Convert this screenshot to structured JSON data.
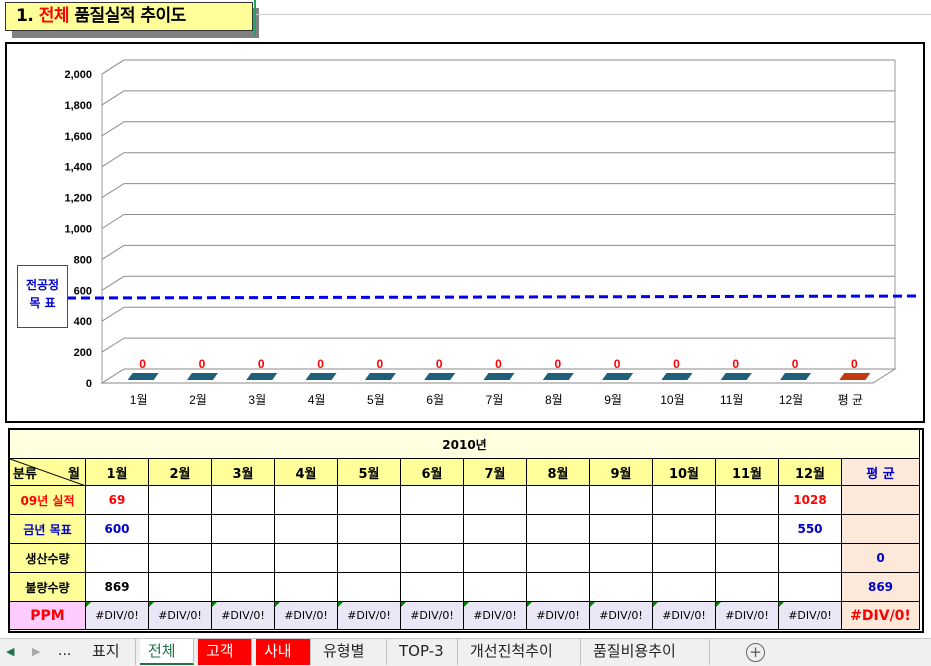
{
  "title": {
    "num": "1.",
    "highlight": "전체",
    "rest": "품질실적 추이도"
  },
  "target_label": {
    "line1": "전공정",
    "line2": "목 표"
  },
  "chart_data": {
    "type": "bar",
    "title": "",
    "categories": [
      "1월",
      "2월",
      "3월",
      "4월",
      "5월",
      "6월",
      "7월",
      "8월",
      "9월",
      "10월",
      "11월",
      "12월",
      "평 균"
    ],
    "series": [
      {
        "values": [
          0,
          0,
          0,
          0,
          0,
          0,
          0,
          0,
          0,
          0,
          0,
          0,
          0
        ]
      }
    ],
    "data_labels": [
      "0",
      "0",
      "0",
      "0",
      "0",
      "0",
      "0",
      "0",
      "0",
      "0",
      "0",
      "0",
      "0"
    ],
    "yticks": [
      "0",
      "200",
      "400",
      "600",
      "800",
      "1,000",
      "1,200",
      "1,400",
      "1,600",
      "1,800",
      "2,000"
    ],
    "ylim": [
      0,
      2000
    ],
    "target_line_value": 550,
    "colors": {
      "bar": "#1f5f7a",
      "avg_bar": "#c0390f",
      "target_line": "#0000ee",
      "labels": "#ff0000"
    }
  },
  "table": {
    "year_label": "2010년",
    "corner_left": "분류",
    "corner_right": "월",
    "months": [
      "1월",
      "2월",
      "3월",
      "4월",
      "5월",
      "6월",
      "7월",
      "8월",
      "9월",
      "10월",
      "11월",
      "12월"
    ],
    "avg_label": "평 균",
    "rows": [
      {
        "label": "09년 실적",
        "values": [
          "69",
          "",
          "",
          "",
          "",
          "",
          "",
          "",
          "",
          "",
          "",
          "1028"
        ],
        "avg": ""
      },
      {
        "label": "금년 목표",
        "values": [
          "600",
          "",
          "",
          "",
          "",
          "",
          "",
          "",
          "",
          "",
          "",
          "550"
        ],
        "avg": ""
      },
      {
        "label": "생산수량",
        "values": [
          "",
          "",
          "",
          "",
          "",
          "",
          "",
          "",
          "",
          "",
          "",
          ""
        ],
        "avg": "0"
      },
      {
        "label": "불량수량",
        "values": [
          "869",
          "",
          "",
          "",
          "",
          "",
          "",
          "",
          "",
          "",
          "",
          ""
        ],
        "avg": "869"
      }
    ],
    "ppm_label": "PPM",
    "ppm_values": [
      "#DIV/0!",
      "#DIV/0!",
      "#DIV/0!",
      "#DIV/0!",
      "#DIV/0!",
      "#DIV/0!",
      "#DIV/0!",
      "#DIV/0!",
      "#DIV/0!",
      "#DIV/0!",
      "#DIV/0!",
      "#DIV/0!"
    ],
    "ppm_avg": "#DIV/0!"
  },
  "sheet_tabs": {
    "nav_prev": "◀",
    "nav_next": "▶",
    "nav_more": "...",
    "tabs": [
      {
        "label": "표지",
        "state": "normal"
      },
      {
        "label": "전체",
        "state": "active"
      },
      {
        "label": "고객",
        "state": "red"
      },
      {
        "label": "사내",
        "state": "red"
      },
      {
        "label": "유형별",
        "state": "normal"
      },
      {
        "label": "TOP-3",
        "state": "normal"
      },
      {
        "label": "개선진척추이",
        "state": "normal"
      },
      {
        "label": "품질비용추이",
        "state": "normal"
      }
    ],
    "add_symbol": "+"
  }
}
